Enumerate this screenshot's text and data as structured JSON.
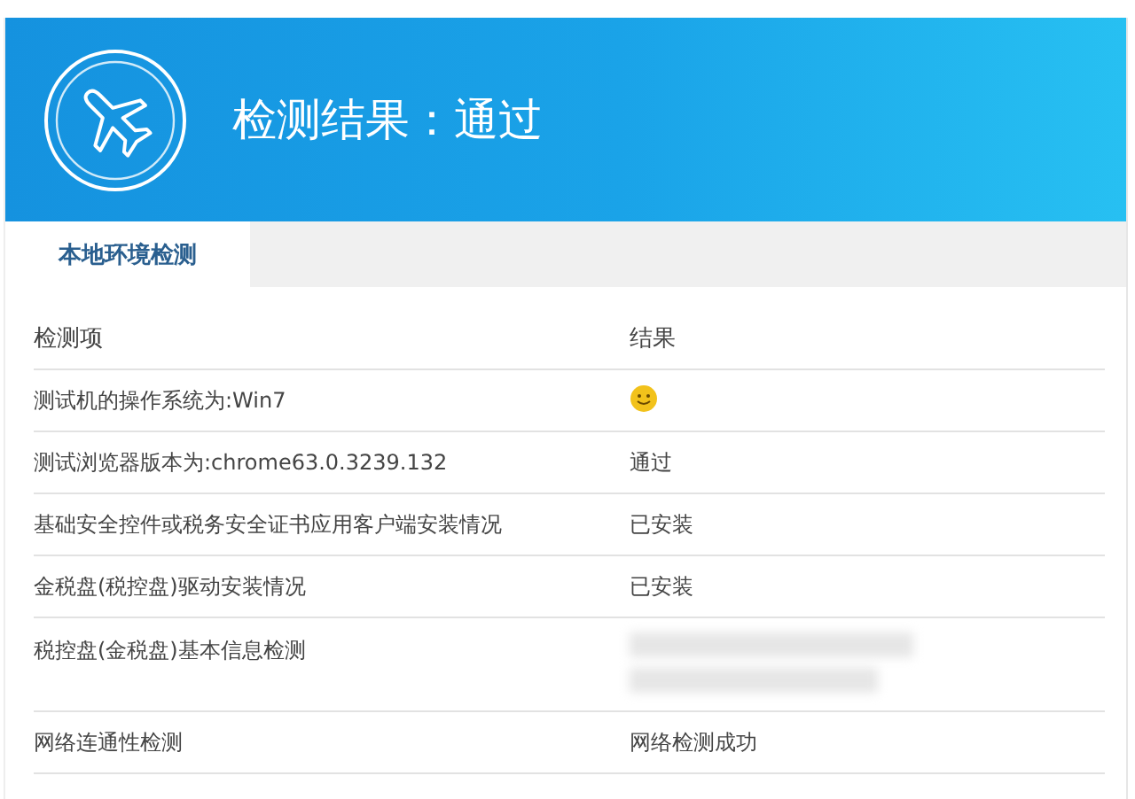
{
  "banner": {
    "title": "检测结果：通过"
  },
  "tabs": [
    {
      "label": "本地环境检测",
      "selected": true
    }
  ],
  "table": {
    "columns": [
      "检测项",
      "结果"
    ],
    "rows": [
      {
        "item": "测试机的操作系统为:Win7",
        "result": {
          "kind": "smiley"
        }
      },
      {
        "item": "测试浏览器版本为:chrome63.0.3239.132",
        "result": {
          "kind": "text",
          "text": "通过"
        }
      },
      {
        "item": "基础安全控件或税务安全证书应用客户端安装情况",
        "result": {
          "kind": "text",
          "text": "已安装"
        }
      },
      {
        "item": "金税盘(税控盘)驱动安装情况",
        "result": {
          "kind": "text",
          "text": "已安装"
        }
      },
      {
        "item": "税控盘(金税盘)基本信息检测",
        "result": {
          "kind": "redacted"
        }
      },
      {
        "item": "网络连通性检测",
        "result": {
          "kind": "text",
          "text": "网络检测成功"
        }
      }
    ]
  }
}
